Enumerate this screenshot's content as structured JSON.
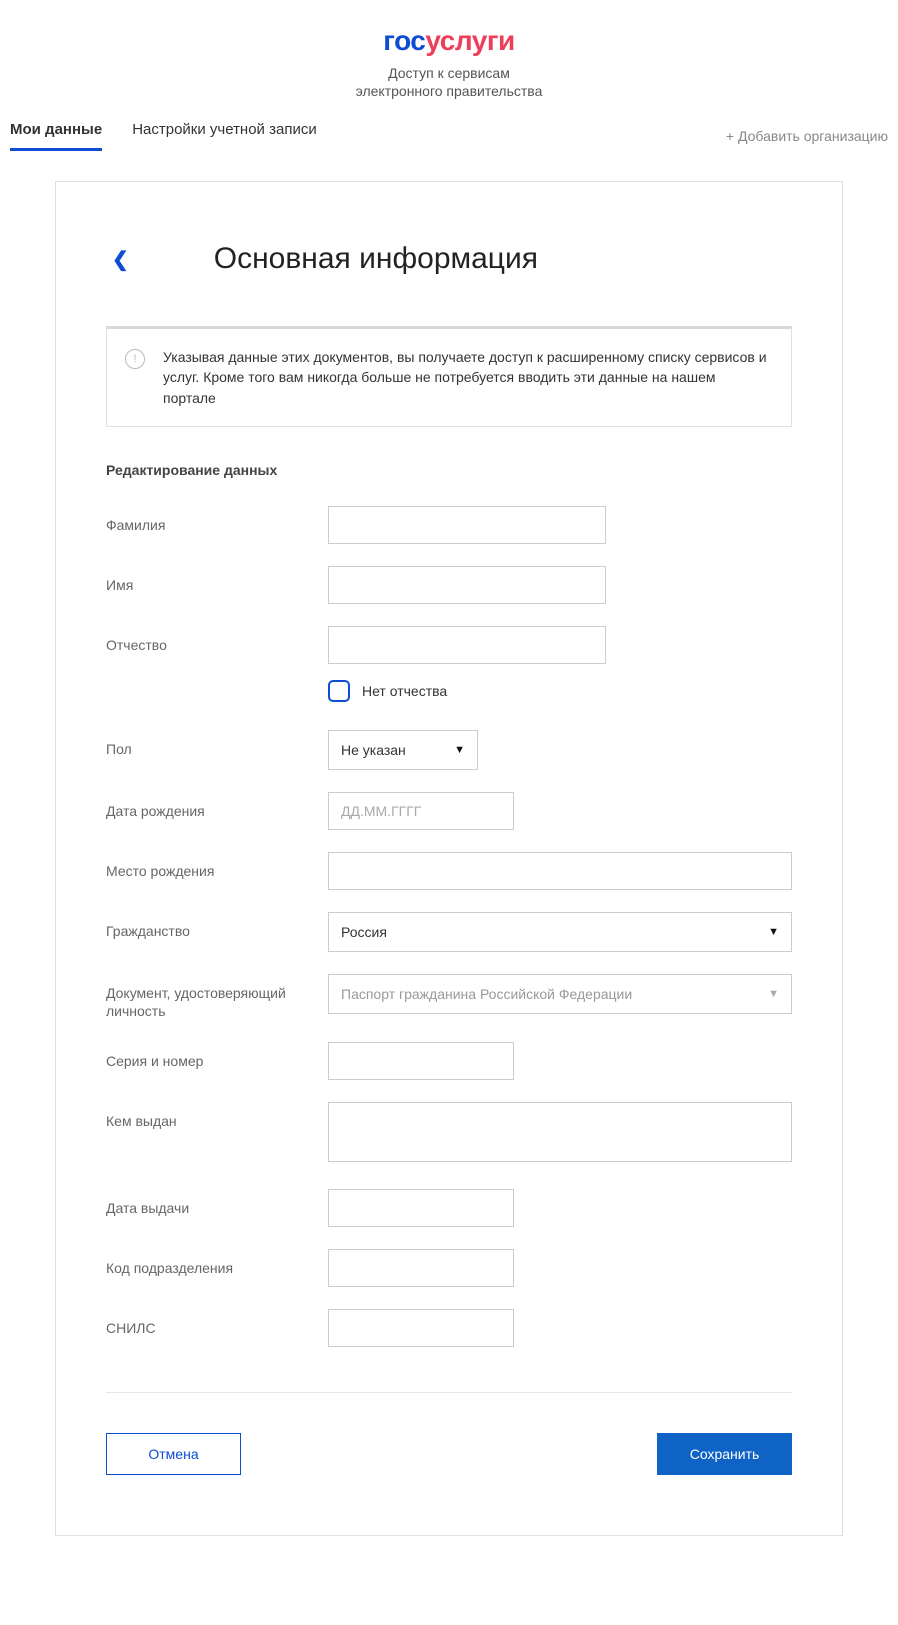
{
  "header": {
    "logo_part1": "гос",
    "logo_part2": "услуги",
    "sub1": "Доступ к сервисам",
    "sub2": "электронного правительства"
  },
  "tabs": {
    "my_data": "Мои данные",
    "settings": "Настройки учетной записи",
    "add_org": "+ Добавить организацию"
  },
  "page": {
    "title": "Основная информация",
    "info_text": "Указывая данные этих документов, вы получаете доступ к расширенному списку сервисов и услуг. Кроме того вам никогда больше не потребуется вводить эти данные на нашем портале",
    "section_title": "Редактирование данных"
  },
  "form": {
    "surname_label": "Фамилия",
    "name_label": "Имя",
    "patronymic_label": "Отчество",
    "no_patronymic_label": "Нет отчества",
    "gender_label": "Пол",
    "gender_value": "Не указан",
    "dob_label": "Дата рождения",
    "dob_placeholder": "ДД.ММ.ГГГГ",
    "birthplace_label": "Место рождения",
    "citizenship_label": "Гражданство",
    "citizenship_value": "Россия",
    "doc_label": "Документ, удостоверяющий личность",
    "doc_value": "Паспорт гражданина Российской Федерации",
    "series_label": "Серия и номер",
    "issued_by_label": "Кем выдан",
    "issue_date_label": "Дата выдачи",
    "dept_code_label": "Код подразделения",
    "snils_label": "СНИЛС"
  },
  "actions": {
    "cancel": "Отмена",
    "save": "Сохранить"
  }
}
